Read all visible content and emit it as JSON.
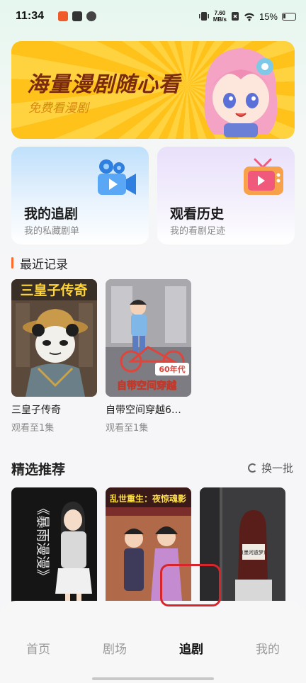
{
  "status_bar": {
    "time": "11:34",
    "net_speed_value": "7.60",
    "net_speed_unit": "MB/s",
    "battery": "15%"
  },
  "banner": {
    "title": "海量漫剧随心看",
    "subtitle": "免费看漫剧"
  },
  "cards": [
    {
      "title": "我的追剧",
      "subtitle": "我的私藏剧单",
      "icon": "video-camera-icon"
    },
    {
      "title": "观看历史",
      "subtitle": "我的看剧足迹",
      "icon": "retro-tv-icon"
    }
  ],
  "recent": {
    "heading": "最近记录",
    "items": [
      {
        "poster_text": "三皇子传奇",
        "title": "三皇子传奇",
        "progress": "观看至1集"
      },
      {
        "poster_text": "60年代",
        "poster_text2": "自带空间穿越",
        "title": "自带空间穿越6…",
        "progress": "观看至1集"
      }
    ]
  },
  "picks": {
    "heading": "精选推荐",
    "refresh_label": "换一批",
    "items": [
      {
        "poster_text": "《暴雨漫漫》"
      },
      {
        "poster_text": "乱世重生：夜惊魂影"
      },
      {
        "poster_text": "(墨河遗梦)"
      }
    ]
  },
  "bottom_nav": {
    "items": [
      "首页",
      "剧场",
      "追剧",
      "我的"
    ],
    "active": "追剧"
  },
  "colors": {
    "accent": "#ff6a2b",
    "highlight_box": "#d8252c",
    "banner_yellow": "#ffd23f"
  }
}
